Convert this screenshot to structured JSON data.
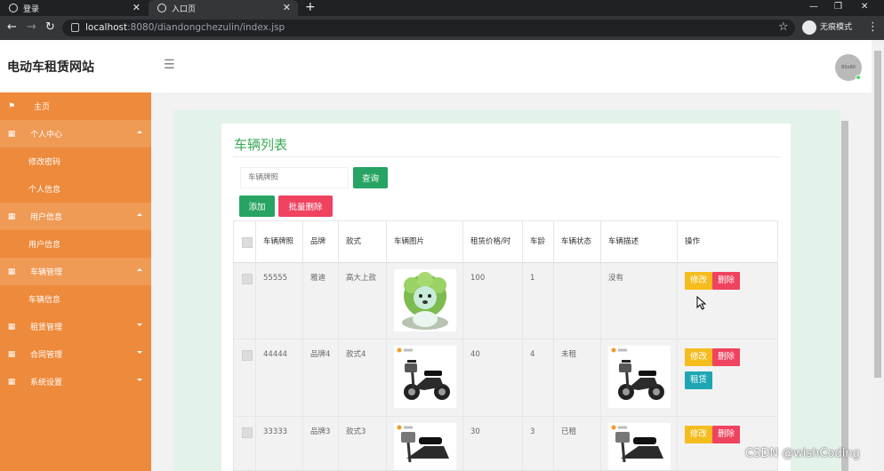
{
  "browser": {
    "tabs": [
      {
        "title": "登录",
        "active": false
      },
      {
        "title": "入口页",
        "active": true
      }
    ],
    "url_host": "localhost",
    "url_rest": ":8080/diandongchezulin/index.jsp",
    "incognito_label": "无痕模式"
  },
  "app": {
    "site_title": "电动车租赁网站",
    "avatar_text": "80x80"
  },
  "sidebar": {
    "items": [
      {
        "label": "主页",
        "type": "top",
        "icon": "flag-icon"
      },
      {
        "label": "个人中心",
        "type": "group",
        "icon": "grid-icon",
        "expanded": true
      },
      {
        "label": "修改密码",
        "type": "sub"
      },
      {
        "label": "个人信息",
        "type": "sub"
      },
      {
        "label": "用户信息",
        "type": "group",
        "icon": "grid-icon",
        "expanded": true
      },
      {
        "label": "用户信息",
        "type": "sub"
      },
      {
        "label": "车辆管理",
        "type": "group",
        "icon": "grid-icon",
        "expanded": true
      },
      {
        "label": "车辆信息",
        "type": "sub"
      },
      {
        "label": "租赁管理",
        "type": "top",
        "icon": "grid-icon",
        "expanded": false
      },
      {
        "label": "合同管理",
        "type": "top",
        "icon": "grid-icon",
        "expanded": false
      },
      {
        "label": "系统设置",
        "type": "top",
        "icon": "grid-icon",
        "expanded": false
      }
    ]
  },
  "main": {
    "title": "车辆列表",
    "search": {
      "placeholder": "车辆牌照"
    },
    "query_label": "查询",
    "add_label": "添加",
    "batch_delete_label": "批量删除",
    "table": {
      "headers": [
        "车辆牌照",
        "品牌",
        "款式",
        "车辆图片",
        "租赁价格/时",
        "车龄",
        "车辆状态",
        "车辆描述",
        "操作"
      ],
      "rows": [
        {
          "plate": "55555",
          "brand": "雅迪",
          "style": "高大上款",
          "image": "green-plush-lion",
          "price": "100",
          "age": "1",
          "status": "",
          "desc": "没有",
          "desc_image": "",
          "actions": [
            "修改",
            "删除"
          ]
        },
        {
          "plate": "44444",
          "brand": "品牌4",
          "style": "款式4",
          "image": "electric-scooter",
          "price": "40",
          "age": "4",
          "status": "未租",
          "desc": "",
          "desc_image": "electric-scooter",
          "actions": [
            "修改",
            "删除",
            "租赁"
          ]
        },
        {
          "plate": "33333",
          "brand": "品牌3",
          "style": "款式3",
          "image": "electric-scooter",
          "price": "30",
          "age": "3",
          "status": "已租",
          "desc": "",
          "desc_image": "electric-scooter",
          "actions": [
            "修改",
            "删除"
          ]
        }
      ]
    }
  },
  "watermark": "CSDN @wishCoding",
  "colors": {
    "sidebar": "#ed8a3b",
    "accent_green": "#27a463",
    "danger": "#f0435f",
    "warning": "#f5bc1e",
    "info": "#1ea6b4",
    "title_green": "#3aa857"
  }
}
